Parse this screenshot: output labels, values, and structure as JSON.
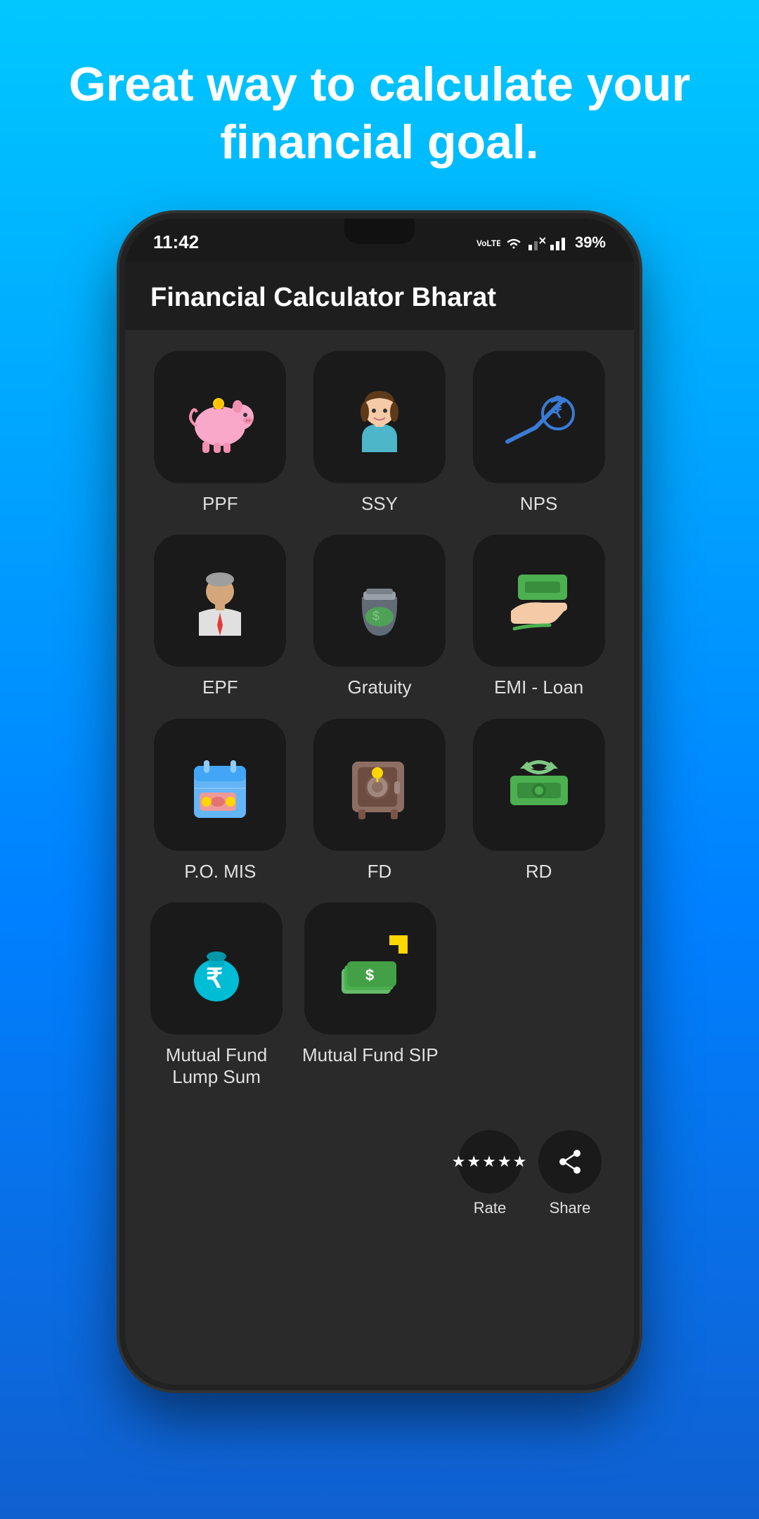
{
  "background": {
    "gradient_start": "#00c8ff",
    "gradient_end": "#1060d0"
  },
  "tagline": "Great way to calculate your financial goal.",
  "status_bar": {
    "time": "11:42",
    "battery": "39%"
  },
  "app": {
    "title": "Financial Calculator Bharat"
  },
  "grid_items": [
    {
      "id": "ppf",
      "label": "PPF",
      "emoji": "🐷"
    },
    {
      "id": "ssy",
      "label": "SSY",
      "emoji": "👧"
    },
    {
      "id": "nps",
      "label": "NPS",
      "emoji": "💰"
    },
    {
      "id": "epf",
      "label": "EPF",
      "emoji": "👔"
    },
    {
      "id": "gratuity",
      "label": "Gratuity",
      "emoji": "🫙"
    },
    {
      "id": "emi",
      "label": "EMI - Loan",
      "emoji": "🤝"
    },
    {
      "id": "pomis",
      "label": "P.O. MIS",
      "emoji": "📅"
    },
    {
      "id": "fd",
      "label": "FD",
      "emoji": "🗄️"
    },
    {
      "id": "rd",
      "label": "RD",
      "emoji": "💵"
    },
    {
      "id": "mflumpsum",
      "label": "Mutual Fund\nLump Sum",
      "emoji": "💼"
    },
    {
      "id": "mfsip",
      "label": "Mutual Fund SIP",
      "emoji": "📈"
    }
  ],
  "actions": [
    {
      "id": "rate",
      "label": "Rate",
      "icon": "⭐",
      "stars": "★★★★★"
    },
    {
      "id": "share",
      "label": "Share",
      "icon": "📤"
    }
  ]
}
